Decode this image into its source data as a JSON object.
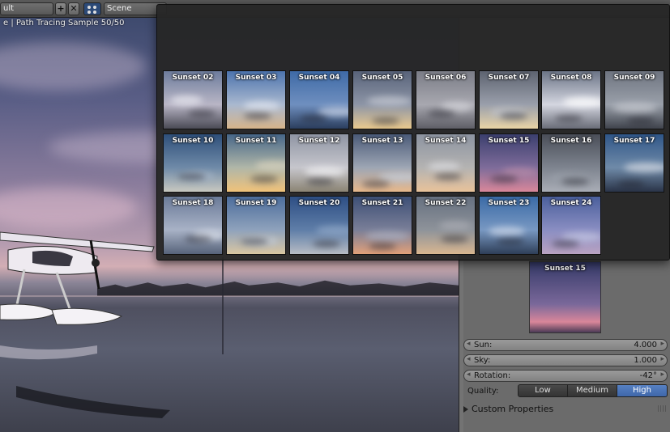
{
  "topbar": {
    "screen_layout": "ult",
    "add_label": "+",
    "close_label": "✕",
    "scene_label": "Scene"
  },
  "viewport": {
    "header_text": "e | Path Tracing Sample 50/50"
  },
  "gallery": {
    "items": [
      {
        "label": "Sunset 02",
        "top": "#6d7c9c",
        "mid": "#b9b6c6",
        "bot": "#4a4a55",
        "cloud": "#e6e6ee"
      },
      {
        "label": "Sunset 03",
        "top": "#4c73ad",
        "mid": "#a9b8cf",
        "bot": "#d6b48a",
        "cloud": "#dde3ee"
      },
      {
        "label": "Sunset 04",
        "top": "#3e6aa6",
        "mid": "#6f8fbf",
        "bot": "#2b3e5e",
        "cloud": "#c7d2e6"
      },
      {
        "label": "Sunset 05",
        "top": "#58637a",
        "mid": "#8d95a6",
        "bot": "#e9c98e",
        "cloud": "#c2c6d0"
      },
      {
        "label": "Sunset 06",
        "top": "#7a7c86",
        "mid": "#a8a8b0",
        "bot": "#5e5e66",
        "cloud": "#d4d4da"
      },
      {
        "label": "Sunset 07",
        "top": "#5d6370",
        "mid": "#9a9fab",
        "bot": "#e9d4a6",
        "cloud": "#bfc3cc"
      },
      {
        "label": "Sunset 08",
        "top": "#6b7486",
        "mid": "#d4d6e0",
        "bot": "#6a6d78",
        "cloud": "#ffffff"
      },
      {
        "label": "Sunset 09",
        "top": "#6e7480",
        "mid": "#9aa0aa",
        "bot": "#3f434c",
        "cloud": "#c5c8cf"
      },
      {
        "label": "Sunset 10",
        "top": "#2e4f7a",
        "mid": "#6f8aa8",
        "bot": "#c8c8c0",
        "cloud": "#a8b8cc"
      },
      {
        "label": "Sunset 11",
        "top": "#466688",
        "mid": "#b0b6a8",
        "bot": "#f0c27a",
        "cloud": "#d6d0bc"
      },
      {
        "label": "Sunset 12",
        "top": "#8f95a4",
        "mid": "#c6c6cc",
        "bot": "#8b8474",
        "cloud": "#f0f0f2"
      },
      {
        "label": "Sunset 13",
        "top": "#4a5a78",
        "mid": "#9ea6b4",
        "bot": "#e7b88c",
        "cloud": "#c6ccd6"
      },
      {
        "label": "Sunset 14",
        "top": "#8c93a0",
        "mid": "#b4b3b2",
        "bot": "#e8c29a",
        "cloud": "#d8d8dc"
      },
      {
        "label": "Sunset 15",
        "top": "#3b3f6e",
        "mid": "#7e6c9a",
        "bot": "#d9879a",
        "cloud": "#b48aa8"
      },
      {
        "label": "Sunset 16",
        "top": "#4a4e58",
        "mid": "#7e848f",
        "bot": "#a9adb6",
        "cloud": "#9aa0aa"
      },
      {
        "label": "Sunset 17",
        "top": "#2f5688",
        "mid": "#6f8aa8",
        "bot": "#2a3448",
        "cloud": "#d0d6e0"
      },
      {
        "label": "Sunset 18",
        "top": "#6a7a98",
        "mid": "#a8b2c6",
        "bot": "#57637a",
        "cloud": "#dfe4ee"
      },
      {
        "label": "Sunset 19",
        "top": "#4c6d9c",
        "mid": "#8fa2bc",
        "bot": "#d9c6a2",
        "cloud": "#c4ccd8"
      },
      {
        "label": "Sunset 20",
        "top": "#2d4e84",
        "mid": "#5f7ea8",
        "bot": "#b7bcc4",
        "cloud": "#8ea6c6"
      },
      {
        "label": "Sunset 21",
        "top": "#3d4f76",
        "mid": "#7a7f98",
        "bot": "#e1a07a",
        "cloud": "#a7adc0"
      },
      {
        "label": "Sunset 22",
        "top": "#667080",
        "mid": "#8e939a",
        "bot": "#d8b690",
        "cloud": "#a8aab2"
      },
      {
        "label": "Sunset 23",
        "top": "#3a6aa6",
        "mid": "#7898c2",
        "bot": "#2e3e58",
        "cloud": "#c8d4e6"
      },
      {
        "label": "Sunset 24",
        "top": "#4a5f9c",
        "mid": "#8a8ec2",
        "bot": "#b9a2c2",
        "cloud": "#c0c4e2"
      }
    ]
  },
  "preview": {
    "label": "Sunset 15",
    "top": "#353a68",
    "mid": "#7a689a",
    "bot": "#d9869a"
  },
  "props": {
    "sun": {
      "label": "Sun:",
      "value": "4.000"
    },
    "sky": {
      "label": "Sky:",
      "value": "1.000"
    },
    "rotation": {
      "label": "Rotation:",
      "value": "-42°"
    },
    "quality": {
      "label": "Quality:",
      "options": [
        "Low",
        "Medium",
        "High"
      ],
      "selected": "High"
    },
    "custom_properties": "Custom Properties"
  },
  "colors": {
    "accent": "#5680c2",
    "popup_bg": "#262626"
  }
}
